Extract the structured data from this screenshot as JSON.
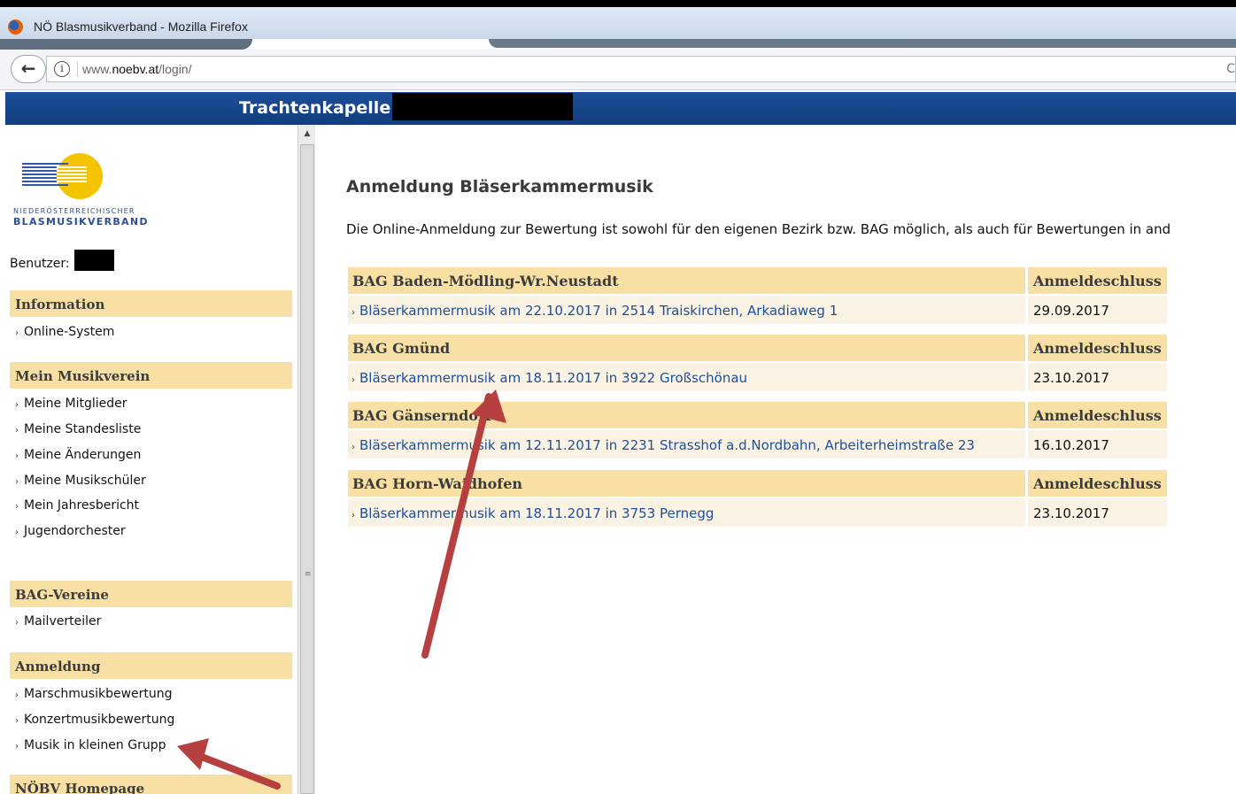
{
  "browser": {
    "window_title": "NÖ Blasmusikverband - Mozilla Firefox",
    "url_prefix": "www.",
    "url_domain": "noebv.at",
    "url_path": "/login/"
  },
  "header": {
    "title": "Trachtenkapelle"
  },
  "sidebar": {
    "logo_line1": "NIEDERÖSTERREICHISCHER",
    "logo_line2": "BLASMUSIKVERBAND",
    "user_label": "Benutzer:",
    "sections": [
      {
        "title": "Information",
        "items": [
          "Online-System"
        ]
      },
      {
        "title": "Mein Musikverein",
        "items": [
          "Meine Mitglieder",
          "Meine Standesliste",
          "Meine Änderungen",
          "Meine Musikschüler",
          "Mein Jahresbericht",
          "Jugendorchester"
        ]
      },
      {
        "title": "BAG-Vereine",
        "items": [
          "Mailverteiler"
        ]
      },
      {
        "title": "Anmeldung",
        "items": [
          "Marschmusikbewertung",
          "Konzertmusikbewertung",
          "Musik in kleinen Grupp"
        ]
      },
      {
        "title": "NÖBV Homepage",
        "items": []
      }
    ]
  },
  "main": {
    "title": "Anmeldung Bläserkammermusik",
    "intro": "Die Online-Anmeldung zur Bewertung ist sowohl für den eigenen Bezirk bzw. BAG möglich, als auch für Bewertungen in and",
    "deadline_label": "Anmeldeschluss",
    "bags": [
      {
        "name": "BAG Baden-Mödling-Wr.Neustadt",
        "event": "Bläserkammermusik am 22.10.2017 in 2514 Traiskirchen, Arkadiaweg 1",
        "deadline": "29.09.2017"
      },
      {
        "name": "BAG Gmünd",
        "event": "Bläserkammermusik am 18.11.2017 in 3922 Großschönau",
        "deadline": "23.10.2017"
      },
      {
        "name": "BAG Gänserndorf",
        "event": "Bläserkammermusik am 12.11.2017 in 2231 Strasshof a.d.Nordbahn, Arbeiterheimstraße 23",
        "deadline": "16.10.2017"
      },
      {
        "name": "BAG Horn-Waidhofen",
        "event": "Bläserkammermusik am 18.11.2017 in 3753 Pernegg",
        "deadline": "23.10.2017"
      }
    ]
  },
  "icons": {
    "back": "back-arrow-icon",
    "info": "info-icon",
    "chevron": "chevron-right-icon"
  },
  "colors": {
    "header_blue": "#1d4f9a",
    "section_bg": "#f8e0a5",
    "row_bg": "#faf3e3",
    "link_blue": "#1d4f9a",
    "annotation_arrow": "#b5403f"
  }
}
